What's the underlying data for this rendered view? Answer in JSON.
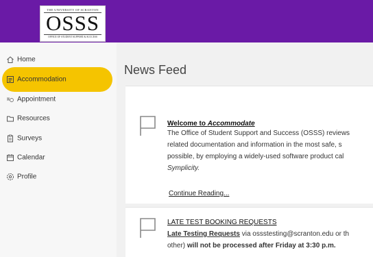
{
  "header": {
    "logo_university": "THE UNIVERSITY OF SCRANTON",
    "logo_mark": "OSSS",
    "logo_office": "OFFICE OF STUDENT SUPPORT & SUCCESS",
    "bg_color": "#6a1aa6"
  },
  "sidebar": {
    "items": [
      {
        "label": "Home",
        "icon": "home-icon",
        "active": false
      },
      {
        "label": "Accommodation",
        "icon": "document-icon",
        "active": true
      },
      {
        "label": "Appointment",
        "icon": "appointment-icon",
        "active": false
      },
      {
        "label": "Resources",
        "icon": "folder-icon",
        "active": false
      },
      {
        "label": "Surveys",
        "icon": "clipboard-icon",
        "active": false
      },
      {
        "label": "Calendar",
        "icon": "calendar-icon",
        "active": false
      },
      {
        "label": "Profile",
        "icon": "gear-icon",
        "active": false
      }
    ],
    "active_color": "#f5c400"
  },
  "main": {
    "title": "News Feed",
    "posts": [
      {
        "icon": "flag-icon",
        "title_prefix": "Welcome to ",
        "title_em": "Accommodate",
        "lines": [
          "The Office of Student Support and Success (OSSS) reviews",
          "related documentation and information in the most safe, s",
          "possible, by employing a widely-used software product cal",
          "Symplicity."
        ],
        "link": "Continue Reading..."
      },
      {
        "icon": "flag-icon",
        "title": "LATE TEST BOOKING REQUESTS",
        "line1_link": "Late Testing Requests",
        "line1_rest": " via ossstesting@scranton.edu or th",
        "line2_pre": "other) ",
        "line2_bold": "will not be processed after Friday at 3:30 p.m."
      }
    ]
  }
}
